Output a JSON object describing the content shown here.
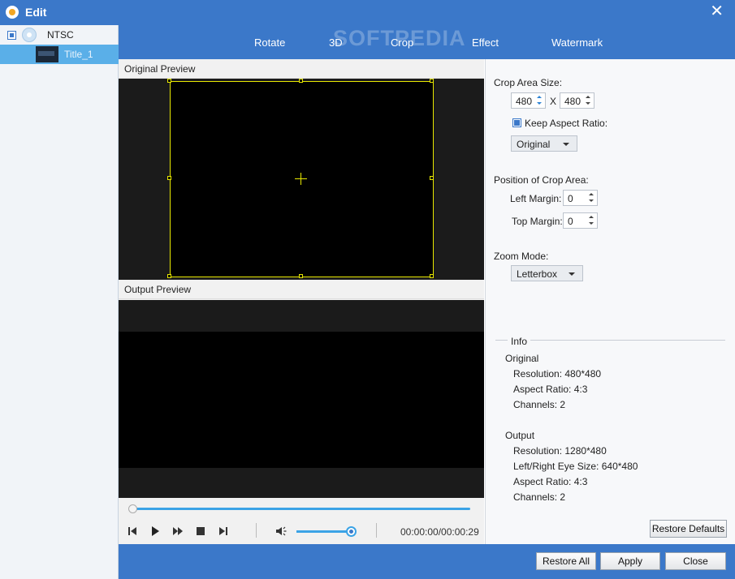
{
  "window": {
    "title": "Edit"
  },
  "tree": {
    "disc": {
      "label": "NTSC"
    },
    "title_item": {
      "label": "Title_1"
    }
  },
  "tabs": [
    {
      "label": "Rotate"
    },
    {
      "label": "3D"
    },
    {
      "label": "Crop"
    },
    {
      "label": "Effect"
    },
    {
      "label": "Watermark"
    }
  ],
  "watermark_text": "SOFTPEDIA",
  "preview": {
    "original_label": "Original Preview",
    "output_label": "Output Preview",
    "progress": 0,
    "volume": 0.93,
    "timecode": "00:00:00/00:00:29"
  },
  "crop": {
    "area_size_label": "Crop Area Size:",
    "width": "480",
    "x_label": "X",
    "height": "480",
    "keep_aspect_label": "Keep Aspect Ratio:",
    "keep_aspect_checked": true,
    "aspect_option": "Original",
    "position_label": "Position of Crop Area:",
    "left_margin_label": "Left Margin:",
    "left_margin": "0",
    "top_margin_label": "Top Margin:",
    "top_margin": "0",
    "zoom_label": "Zoom Mode:",
    "zoom_option": "Letterbox"
  },
  "info": {
    "title": "Info",
    "original": {
      "heading": "Original",
      "resolution": "Resolution: 480*480",
      "aspect": "Aspect Ratio: 4:3",
      "channels": "Channels: 2"
    },
    "output": {
      "heading": "Output",
      "resolution": "Resolution: 1280*480",
      "eye_size": "Left/Right Eye Size: 640*480",
      "aspect": "Aspect Ratio: 4:3",
      "channels": "Channels: 2"
    }
  },
  "buttons": {
    "restore_defaults": "Restore Defaults",
    "restore_all": "Restore All",
    "apply": "Apply",
    "close": "Close"
  },
  "colors": {
    "accent": "#3b78c9",
    "selection": "#5aafe8",
    "crop_frame": "#e8e800",
    "slider": "#3ba3e6"
  }
}
